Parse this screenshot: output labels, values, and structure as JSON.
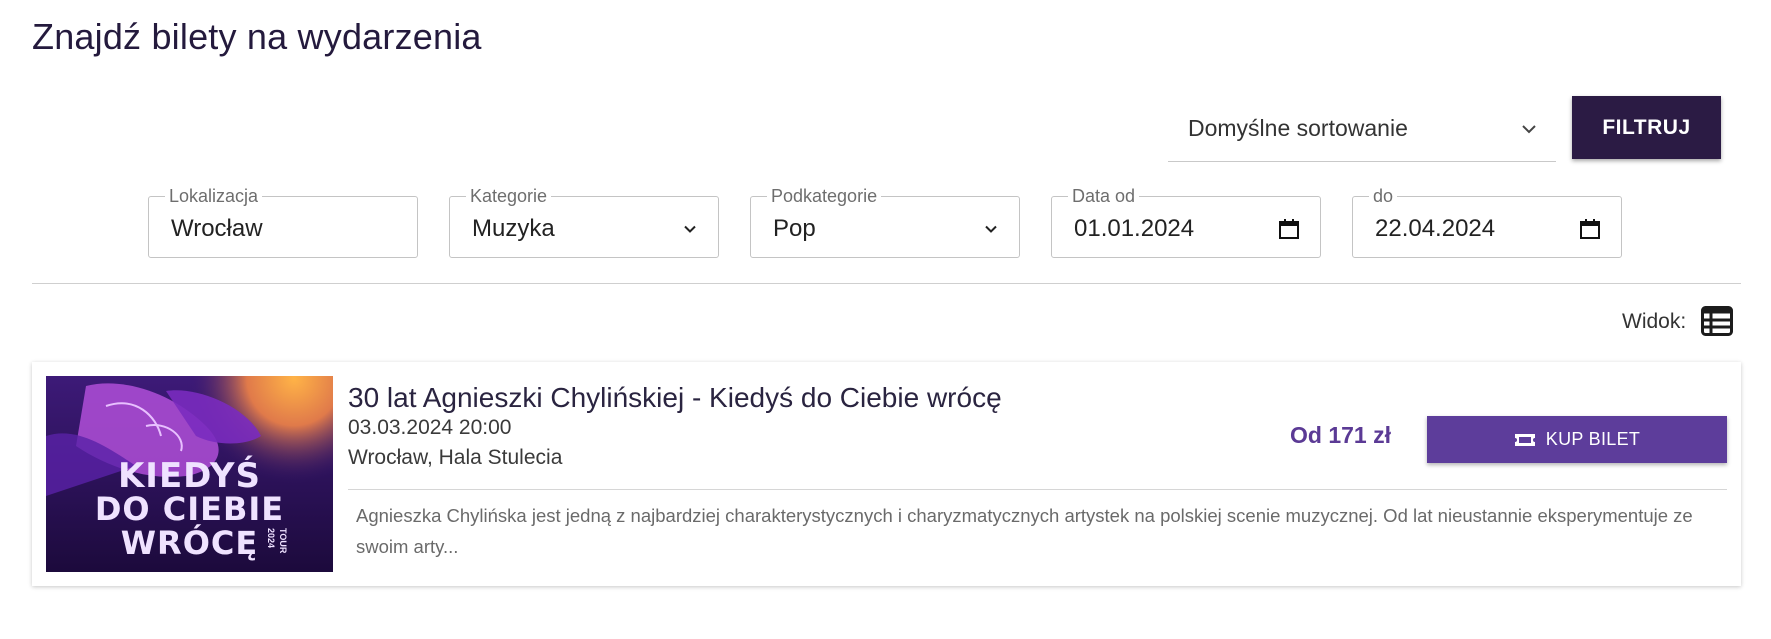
{
  "page_title": "Znajdź bilety na wydarzenia",
  "sort": {
    "selected": "Domyślne sortowanie"
  },
  "filter_button": "FILTRUJ",
  "filters": {
    "location": {
      "label": "Lokalizacja",
      "value": "Wrocław"
    },
    "category": {
      "label": "Kategorie",
      "value": "Muzyka"
    },
    "subcategory": {
      "label": "Podkategorie",
      "value": "Pop"
    },
    "date_from": {
      "label": "Data od",
      "value": "01.01.2024"
    },
    "date_to": {
      "label": "do",
      "value": "22.04.2024"
    }
  },
  "view": {
    "label": "Widok:",
    "icon": "list-view-icon"
  },
  "events": [
    {
      "title": "30 lat Agnieszki Chylińskiej - Kiedyś do Ciebie wrócę",
      "date": "03.03.2024 20:00",
      "place": "Wrocław, Hala Stulecia",
      "price": "Od 171 zł",
      "buy_label": "KUP BILET",
      "buy_icon": "ticket-icon",
      "description": "Agnieszka Chylińska jest jedną z najbardziej charakterystycznych i charyzmatycznych artystek na polskiej scenie muzycznej. Od lat nieustannie eksperymentuje ze swoim arty...",
      "poster": {
        "line1": "KIEDYŚ",
        "line2": "DO CIEBIE",
        "line3": "WRÓCĘ",
        "year": "2024",
        "tour": "TOUR"
      }
    }
  ],
  "colors": {
    "primary_dark": "#2b1b44",
    "accent_purple": "#5d3d9b",
    "price_purple": "#5b3a95"
  }
}
